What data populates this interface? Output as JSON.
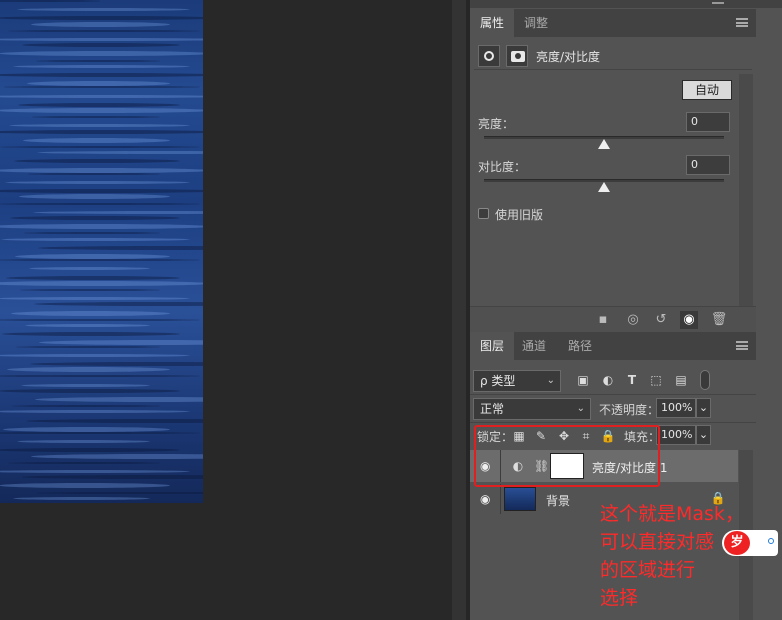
{
  "properties_panel": {
    "tabs": [
      {
        "label": "属性"
      },
      {
        "label": "调整"
      }
    ],
    "title": "亮度/对比度",
    "auto_label": "自动",
    "brightness_label": "亮度：",
    "brightness_value": "0",
    "contrast_label": "对比度：",
    "contrast_value": "0",
    "legacy_label": "使用旧版"
  },
  "layers_panel": {
    "tabs": [
      {
        "label": "图层"
      },
      {
        "label": "通道"
      },
      {
        "label": "路径"
      }
    ],
    "filter_kind": "ρ 类型",
    "blend_mode": "正常",
    "opacity_label": "不透明度：",
    "opacity_value": "100%",
    "lock_label": "锁定：",
    "fill_label": "填充：",
    "fill_value": "100%",
    "layers": [
      {
        "name": "亮度/对比度 1"
      },
      {
        "name": "背景"
      }
    ]
  },
  "annotation": {
    "lines": [
      "这个就是Mask，",
      "可以直接对感",
      "的区域进行",
      "选择"
    ],
    "logo_text": "岁"
  },
  "colors": {
    "panel_bg": "#535353",
    "annotation_red": "#ff2a2a"
  }
}
